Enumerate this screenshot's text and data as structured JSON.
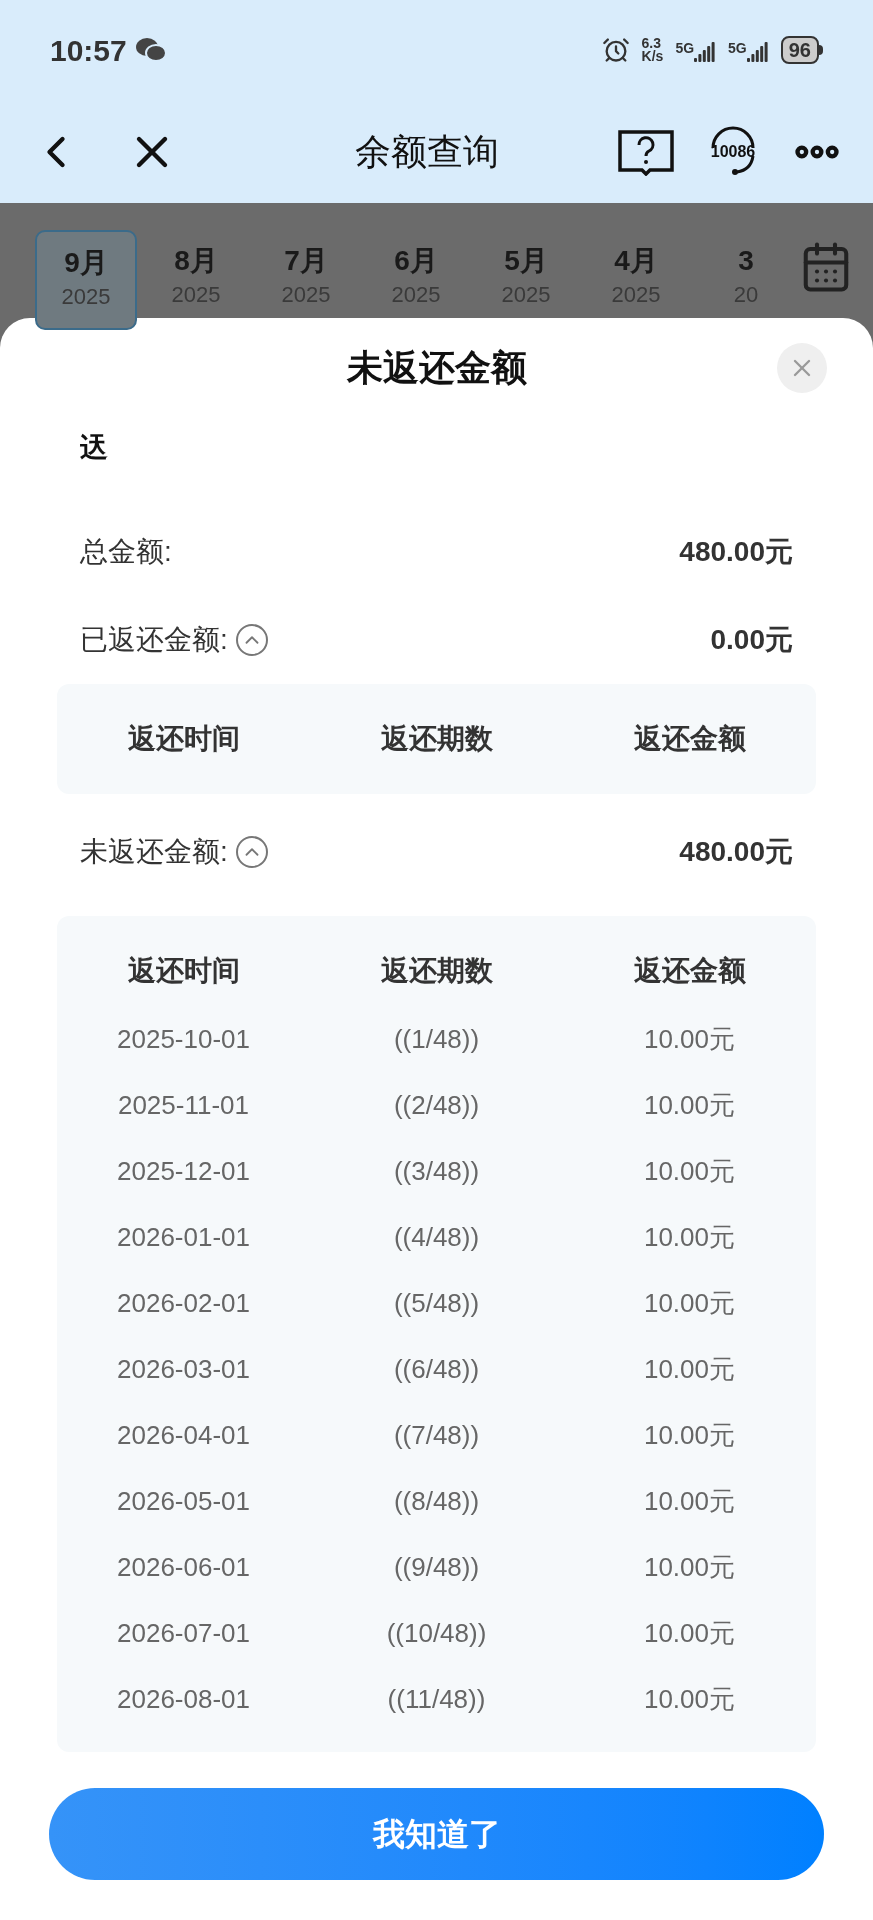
{
  "status_bar": {
    "time": "10:57",
    "speed_value": "6.3",
    "speed_unit": "K/s",
    "networks": [
      "5G",
      "5G"
    ],
    "battery": "96"
  },
  "header": {
    "title": "余额查询",
    "service_number": "10086"
  },
  "months": [
    {
      "month": "9月",
      "year": "2025",
      "selected": true
    },
    {
      "month": "8月",
      "year": "2025",
      "selected": false
    },
    {
      "month": "7月",
      "year": "2025",
      "selected": false
    },
    {
      "month": "6月",
      "year": "2025",
      "selected": false
    },
    {
      "month": "5月",
      "year": "2025",
      "selected": false
    },
    {
      "month": "4月",
      "year": "2025",
      "selected": false
    },
    {
      "month": "3",
      "year": "20",
      "selected": false
    }
  ],
  "sheet": {
    "title": "未返还金额",
    "subtitle": "迗",
    "total": {
      "label": "总金额:",
      "value": "480.00元"
    },
    "returned": {
      "label": "已返还金额:",
      "value": "0.00元",
      "expanded": true,
      "columns": [
        "返还时间",
        "返还期数",
        "返还金额"
      ]
    },
    "unreturned": {
      "label": "未返还金额:",
      "value": "480.00元",
      "expanded": true,
      "columns": [
        "返还时间",
        "返还期数",
        "返还金额"
      ],
      "rows": [
        [
          "2025-10-01",
          "((1/48))",
          "10.00元"
        ],
        [
          "2025-11-01",
          "((2/48))",
          "10.00元"
        ],
        [
          "2025-12-01",
          "((3/48))",
          "10.00元"
        ],
        [
          "2026-01-01",
          "((4/48))",
          "10.00元"
        ],
        [
          "2026-02-01",
          "((5/48))",
          "10.00元"
        ],
        [
          "2026-03-01",
          "((6/48))",
          "10.00元"
        ],
        [
          "2026-04-01",
          "((7/48))",
          "10.00元"
        ],
        [
          "2026-05-01",
          "((8/48))",
          "10.00元"
        ],
        [
          "2026-06-01",
          "((9/48))",
          "10.00元"
        ],
        [
          "2026-07-01",
          "((10/48))",
          "10.00元"
        ],
        [
          "2026-08-01",
          "((11/48))",
          "10.00元"
        ]
      ]
    },
    "button": "我知道了"
  }
}
